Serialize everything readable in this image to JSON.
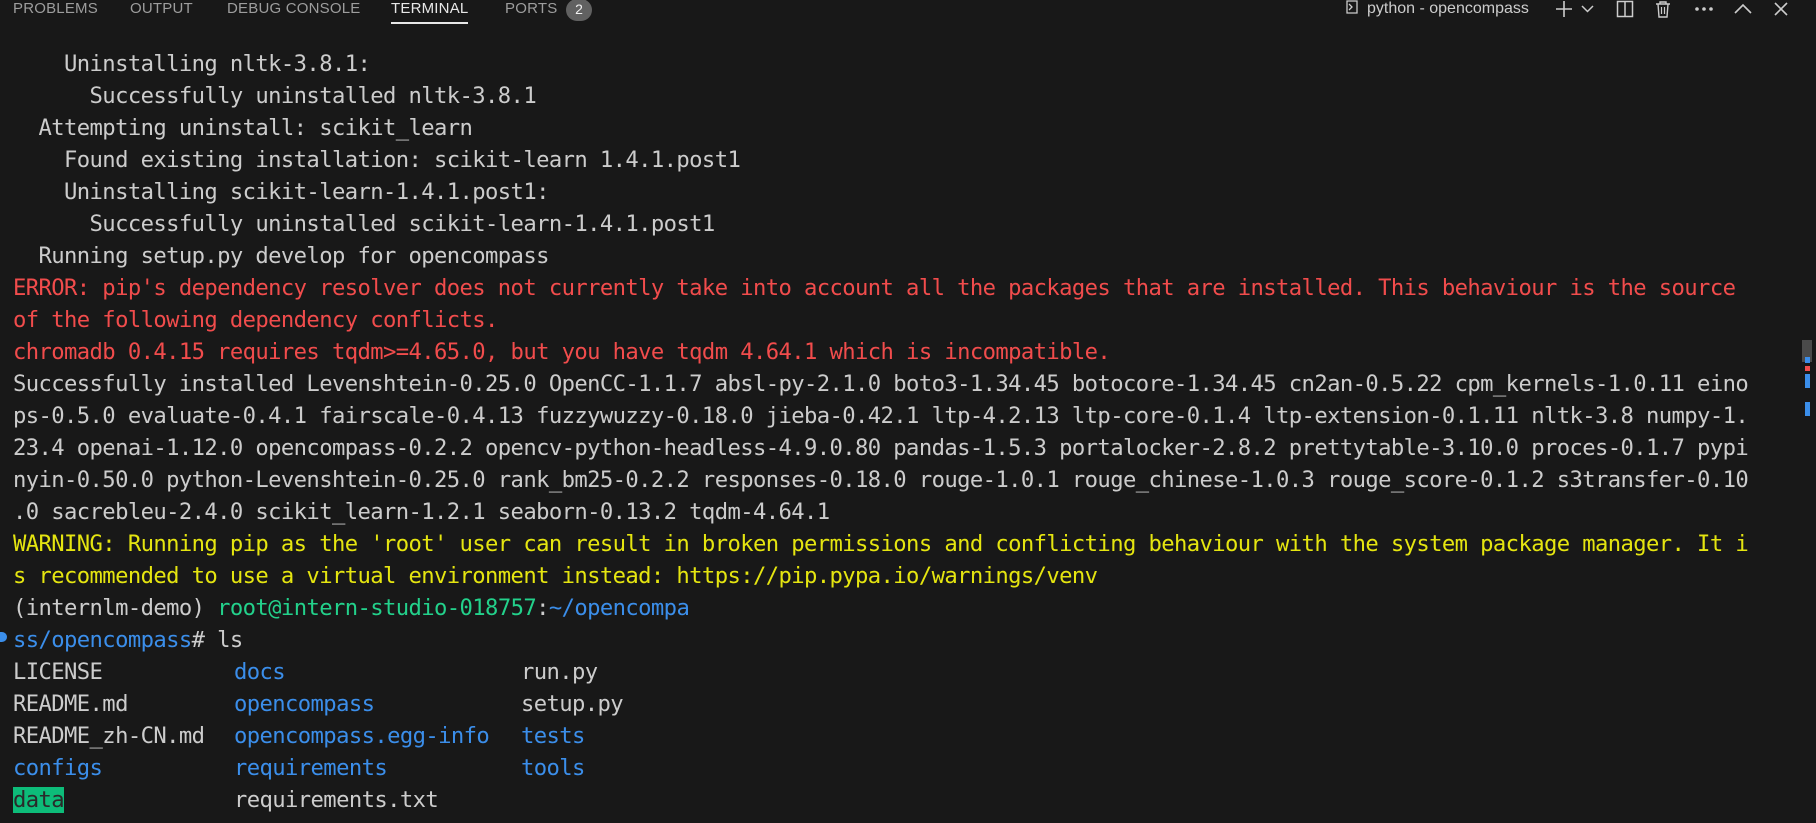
{
  "panel": {
    "tabs": [
      {
        "label": "PROBLEMS"
      },
      {
        "label": "OUTPUT"
      },
      {
        "label": "DEBUG CONSOLE"
      },
      {
        "label": "TERMINAL"
      },
      {
        "label": "PORTS"
      }
    ],
    "ports_badge": "2",
    "terminal_title": "python - opencompass",
    "icons": [
      "terminal-icon",
      "plus-icon",
      "chevron-down-icon",
      "split-icon",
      "trash-icon",
      "ellipsis-icon",
      "chevron-up-icon",
      "close-icon"
    ]
  },
  "terminal": {
    "lines": [
      "    Uninstalling nltk-3.8.1:",
      "      Successfully uninstalled nltk-3.8.1",
      "  Attempting uninstall: scikit_learn",
      "    Found existing installation: scikit-learn 1.4.1.post1",
      "    Uninstalling scikit-learn-1.4.1.post1:",
      "      Successfully uninstalled scikit-learn-1.4.1.post1",
      "  Running setup.py develop for opencompass"
    ],
    "error_lines": [
      "ERROR: pip's dependency resolver does not currently take into account all the packages that are installed. This behaviour is the source",
      "of the following dependency conflicts.",
      "chromadb 0.4.15 requires tqdm>=4.65.0, but you have tqdm 4.64.1 which is incompatible."
    ],
    "installed_lines": [
      "Successfully installed Levenshtein-0.25.0 OpenCC-1.1.7 absl-py-2.1.0 boto3-1.34.45 botocore-1.34.45 cn2an-0.5.22 cpm_kernels-1.0.11 eino",
      "ps-0.5.0 evaluate-0.4.1 fairscale-0.4.13 fuzzywuzzy-0.18.0 jieba-0.42.1 ltp-4.2.13 ltp-core-0.1.4 ltp-extension-0.1.11 nltk-3.8 numpy-1.",
      "23.4 openai-1.12.0 opencompass-0.2.2 opencv-python-headless-4.9.0.80 pandas-1.5.3 portalocker-2.8.2 prettytable-3.10.0 proces-0.1.7 pypi",
      "nyin-0.50.0 python-Levenshtein-0.25.0 rank_bm25-0.2.2 responses-0.18.0 rouge-1.0.1 rouge_chinese-1.0.3 rouge_score-0.1.2 s3transfer-0.10",
      ".0 sacrebleu-2.4.0 scikit_learn-1.2.1 seaborn-0.13.2 tqdm-4.64.1"
    ],
    "warning_lines": [
      "WARNING: Running pip as the 'root' user can result in broken permissions and conflicting behaviour with the system package manager. It i",
      "s recommended to use a virtual environment instead: https://pip.pypa.io/warnings/venv"
    ],
    "prompt": {
      "env": "(internlm-demo) ",
      "user_host": "root@intern-studio-018757",
      "colon": ":",
      "path_part1": "~/opencompa",
      "path_part2": "ss/opencompass",
      "symbol": "# ",
      "command": "ls"
    },
    "ls_entries": [
      {
        "name": "LICENSE",
        "kind": "file"
      },
      {
        "name": "README.md",
        "kind": "file"
      },
      {
        "name": "README_zh-CN.md",
        "kind": "file"
      },
      {
        "name": "configs",
        "kind": "dir"
      },
      {
        "name": "data",
        "kind": "dir-highlight"
      },
      {
        "name": "docs",
        "kind": "dir"
      },
      {
        "name": "opencompass",
        "kind": "dir"
      },
      {
        "name": "opencompass.egg-info",
        "kind": "dir"
      },
      {
        "name": "requirements",
        "kind": "dir"
      },
      {
        "name": "requirements.txt",
        "kind": "file"
      },
      {
        "name": "run.py",
        "kind": "file"
      },
      {
        "name": "setup.py",
        "kind": "file"
      },
      {
        "name": "tests",
        "kind": "dir"
      },
      {
        "name": "tools",
        "kind": "dir"
      }
    ]
  },
  "colors": {
    "background": "#181818",
    "text": "#cccccc",
    "error": "#f14c4c",
    "warning": "#e5e510",
    "prompt_green": "#23d18b",
    "dir_blue": "#3b8eea",
    "highlight_green": "#0dbc79"
  }
}
